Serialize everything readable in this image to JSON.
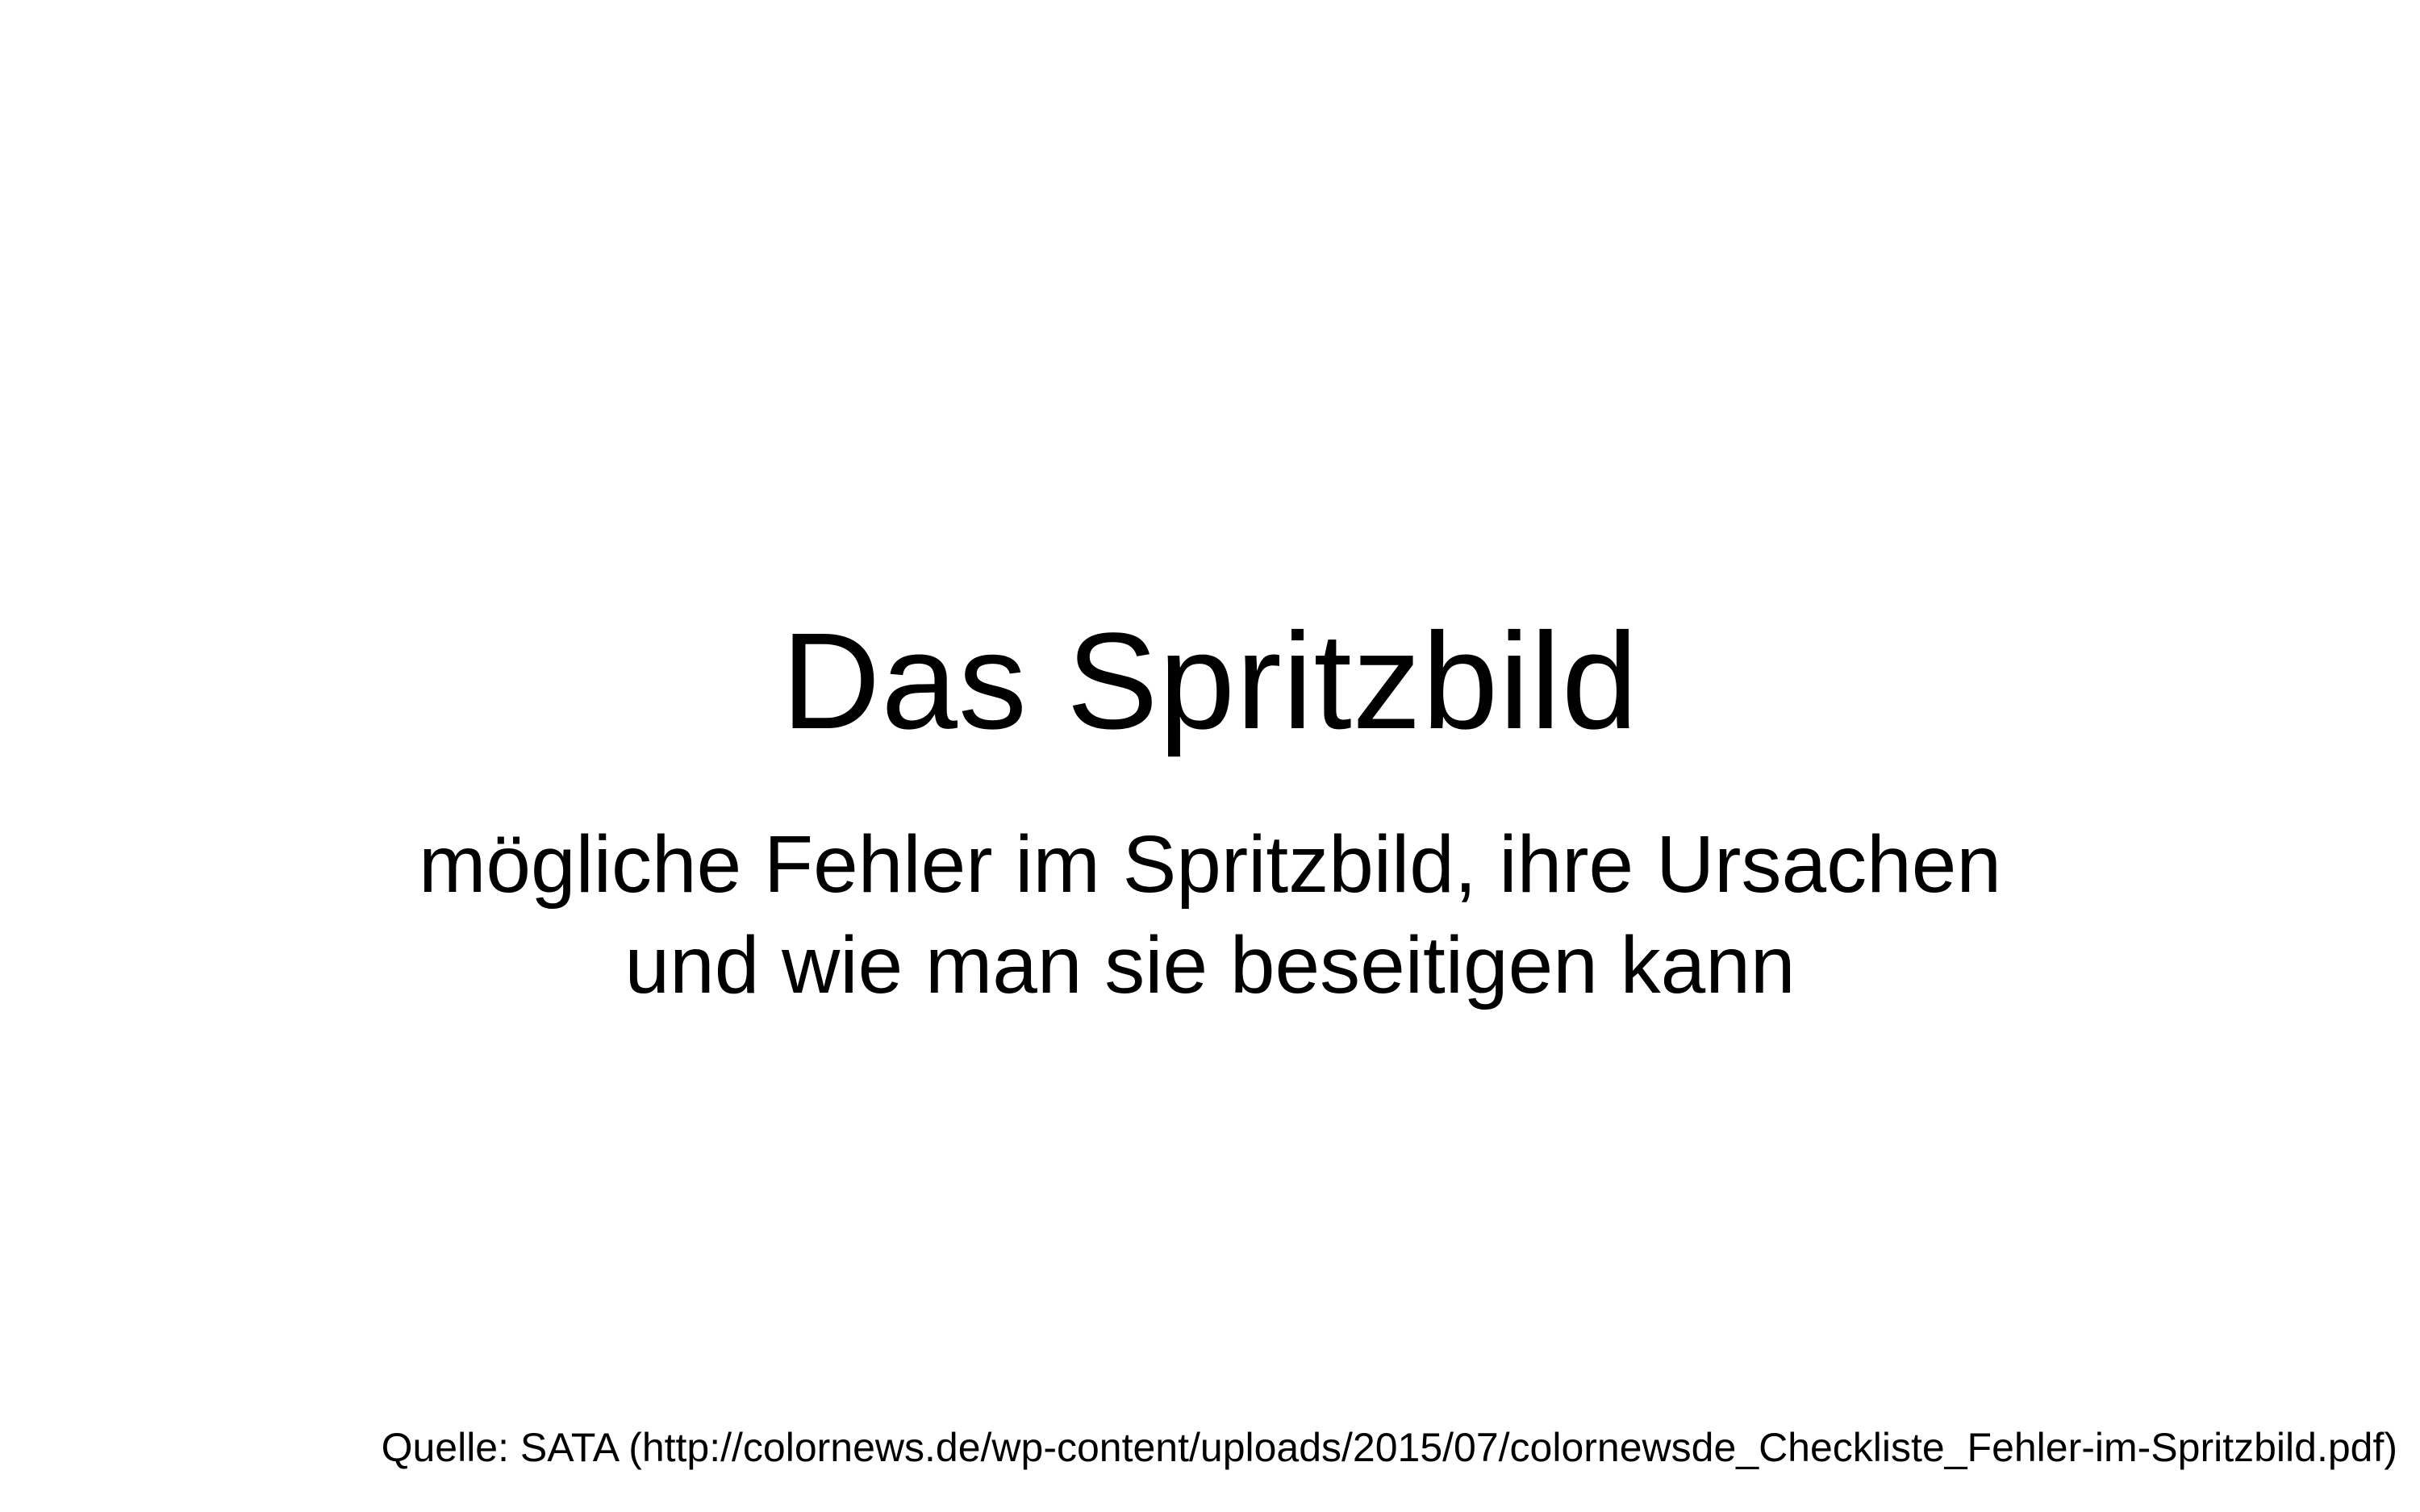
{
  "slide": {
    "title": "Das Spritzbild",
    "subtitle_lines": [
      "mögliche Fehler im Spritzbild, ihre Ursachen",
      "und wie man sie beseitigen kann"
    ],
    "source": "Quelle: SATA (http://colornews.de/wp-content/uploads/2015/07/colornewsde_Checkliste_Fehler-im-Spritzbild.pdf)"
  },
  "colors": {
    "background": "#ffffff",
    "text": "#000000"
  }
}
